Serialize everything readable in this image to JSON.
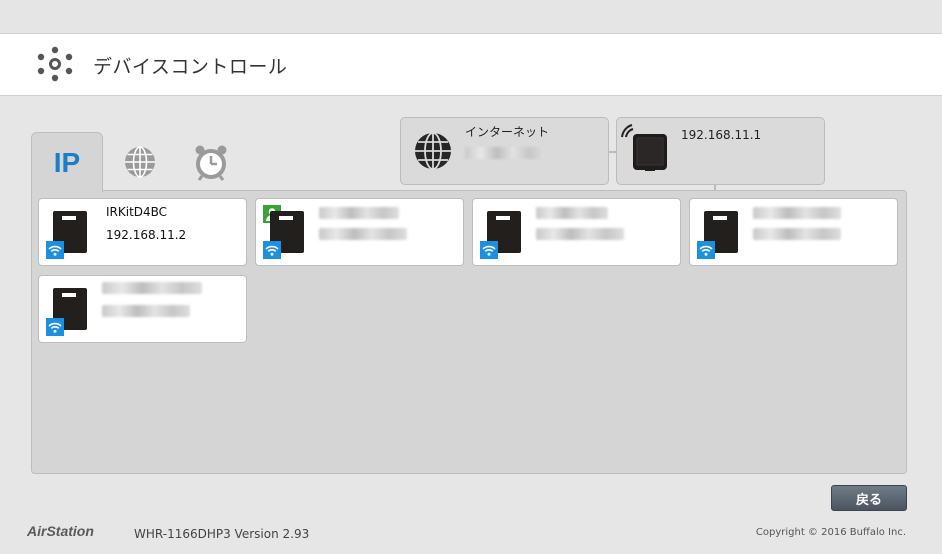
{
  "header": {
    "title": "デバイスコントロール",
    "icon": "gear-icon"
  },
  "tabs": [
    {
      "label": "IP",
      "icon": "ip-text",
      "active": true
    },
    {
      "label": "",
      "icon": "globe-icon",
      "active": false
    },
    {
      "label": "",
      "icon": "alarm-clock-icon",
      "active": false
    }
  ],
  "topology": {
    "internet": {
      "label": "インターネット",
      "address": ""
    },
    "router": {
      "address": "192.168.11.1"
    }
  },
  "devices": [
    {
      "name": "IRKitD4BC",
      "address": "192.168.11.2",
      "connection": "wifi"
    },
    {
      "name": "",
      "address": "",
      "connection": "wifi",
      "badge": "person"
    },
    {
      "name": "",
      "address": "",
      "connection": "wifi"
    },
    {
      "name": "",
      "address": "",
      "connection": "wifi"
    },
    {
      "name": "",
      "address": "",
      "connection": "wifi"
    }
  ],
  "buttons": {
    "back_label": "戻る"
  },
  "footer": {
    "brand": "AirStation",
    "model": "WHR-1166DHP3 Version 2.93",
    "copyright": "Copyright © 2016 Buffalo Inc."
  },
  "colors": {
    "accent": "#1a7fc7",
    "wifi": "#1d8fe0",
    "person_badge": "#3aa335"
  }
}
